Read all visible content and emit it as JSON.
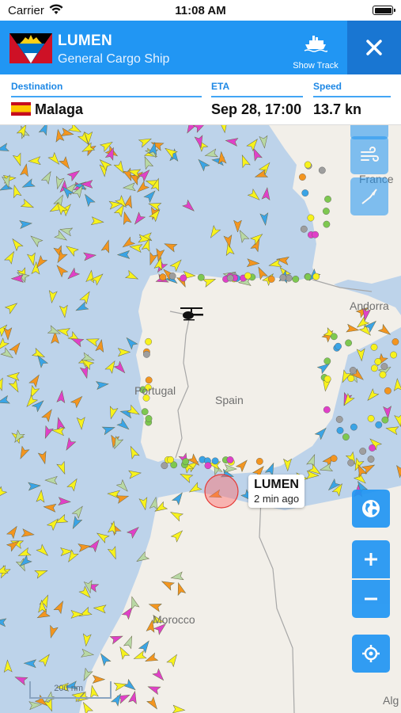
{
  "status_bar": {
    "carrier": "Carrier",
    "time": "11:08 AM"
  },
  "vessel": {
    "name": "LUMEN",
    "type": "General Cargo Ship",
    "flag_icon": "antigua-and-barbuda-flag-icon",
    "show_track_label": "Show Track",
    "header_color": "#2196f3",
    "close_color": "#1976d2"
  },
  "info": {
    "destination_label": "Destination",
    "destination_value": "Malaga",
    "destination_flag_icon": "spain-flag-icon",
    "eta_label": "ETA",
    "eta_value": "Sep 28, 17:00",
    "speed_label": "Speed",
    "speed_value": "13.7 kn"
  },
  "map": {
    "labels": {
      "france": "France",
      "andorra": "Andorra",
      "portugal": "Portugal",
      "spain": "Spain",
      "morocco": "Morocco",
      "algeria": "Alg"
    },
    "callout": {
      "name": "LUMEN",
      "time_ago": "2 min ago"
    },
    "scale": "200 nm",
    "colors": {
      "sea": "#bdd3ea",
      "land": "#f2efe9",
      "cargo": "#f7f21c",
      "tanker": "#f3951f",
      "passenger": "#3aa4e6",
      "fishing": "#e040c8",
      "other": "#b8d8a4",
      "selected_ring": "#ff6b6b"
    },
    "controls": {
      "layers_icon": "layers-icon",
      "wind_icon": "wind-icon",
      "compass_icon": "compass-icon",
      "globe_icon": "globe-icon",
      "zoom_in_icon": "plus-icon",
      "zoom_out_icon": "minus-icon",
      "locate_icon": "crosshair-icon"
    }
  }
}
